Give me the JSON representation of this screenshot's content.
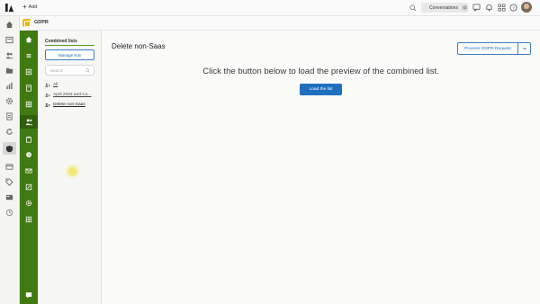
{
  "topbar": {
    "add_label": "Add",
    "conversations_label": "Conversations",
    "conversations_count": "0"
  },
  "subbar": {
    "title": "GDPR"
  },
  "panel": {
    "title": "Combined lists",
    "manage_label": "Manage lists",
    "search_placeholder": "Search",
    "items": [
      {
        "label": "All",
        "icon": "list-icon"
      },
      {
        "label": "April 2022 and Co...",
        "icon": "list-icon"
      },
      {
        "label": "Delete non-Saas",
        "icon": "list-icon",
        "selected": true
      }
    ]
  },
  "main": {
    "title": "Delete non-Saas",
    "process_label": "Process GDPR Request",
    "prompt": "Click the button below to load the preview of the combined list.",
    "load_label": "Load the list"
  },
  "colors": {
    "accent_green": "#3f7a12",
    "primary_blue": "#1f6fc0",
    "gdpr_yellow": "#f2b705"
  }
}
